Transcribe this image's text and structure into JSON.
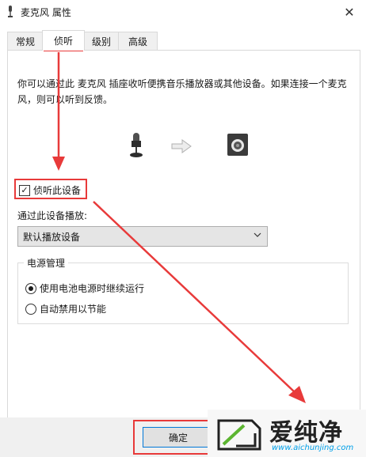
{
  "window": {
    "title": "麦克风 属性",
    "close_glyph": "✕"
  },
  "tabs": [
    {
      "label": "常规"
    },
    {
      "label": "侦听"
    },
    {
      "label": "级别"
    },
    {
      "label": "高级"
    }
  ],
  "listen": {
    "description": "你可以通过此 麦克风 插座收听便携音乐播放器或其他设备。如果连接一个麦克风，则可以听到反馈。",
    "listen_checkbox_label": "侦听此设备",
    "listen_checked": true,
    "playback_label": "通过此设备播放:",
    "playback_value": "默认播放设备",
    "power_group_title": "电源管理",
    "power_options": [
      {
        "label": "使用电池电源时继续运行",
        "selected": true
      },
      {
        "label": "自动禁用以节能",
        "selected": false
      }
    ]
  },
  "footer": {
    "ok_label": "确定"
  },
  "watermark": {
    "brand": "爱纯净",
    "url": "www.aichunjing.com"
  },
  "icons": {
    "title": "microphone-icon",
    "source": "microphone-icon",
    "flow": "arrow-right-icon",
    "target": "speaker-icon"
  },
  "annotation_color": "#e83a3a"
}
